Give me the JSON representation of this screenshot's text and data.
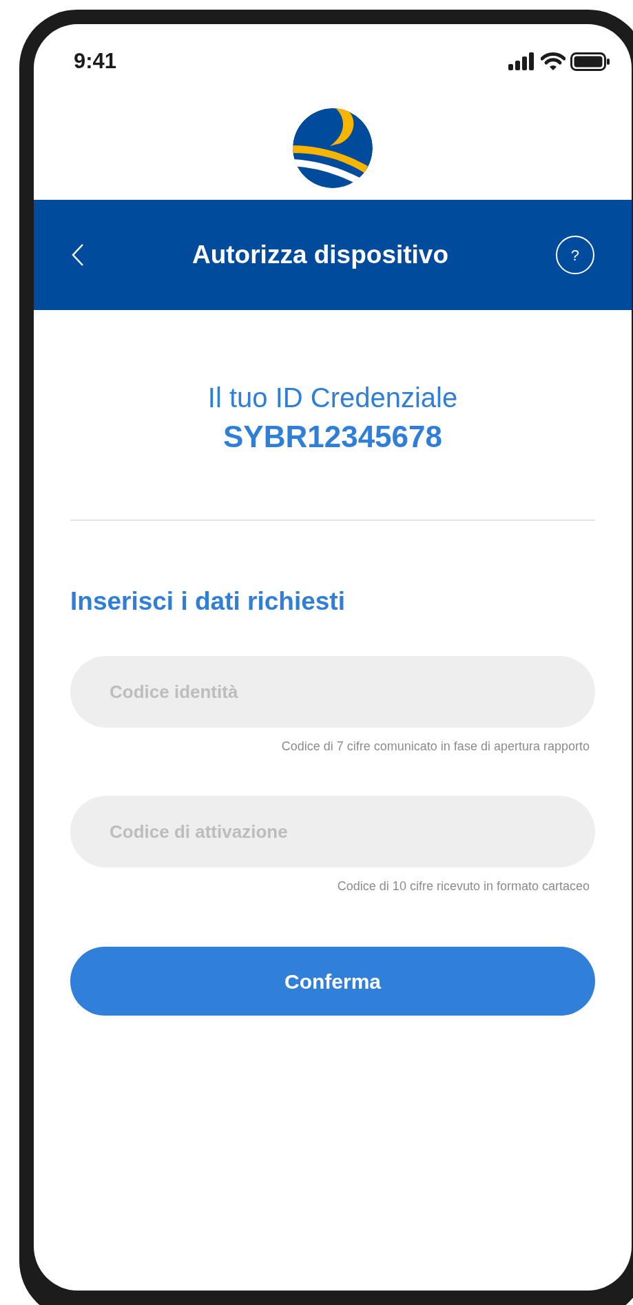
{
  "status_bar": {
    "time": "9:41"
  },
  "header": {
    "title": "Autorizza dispositivo",
    "help": "?"
  },
  "credential": {
    "label": "Il tuo ID Credenziale",
    "id": "SYBR12345678"
  },
  "form": {
    "heading": "Inserisci i dati richiesti",
    "fields": [
      {
        "placeholder": "Codice identità",
        "hint": "Codice di 7 cifre comunicato in fase di apertura rapporto"
      },
      {
        "placeholder": "Codice di attivazione",
        "hint": "Codice di 10 cifre ricevuto in formato cartaceo"
      }
    ],
    "submit": "Conferma"
  }
}
